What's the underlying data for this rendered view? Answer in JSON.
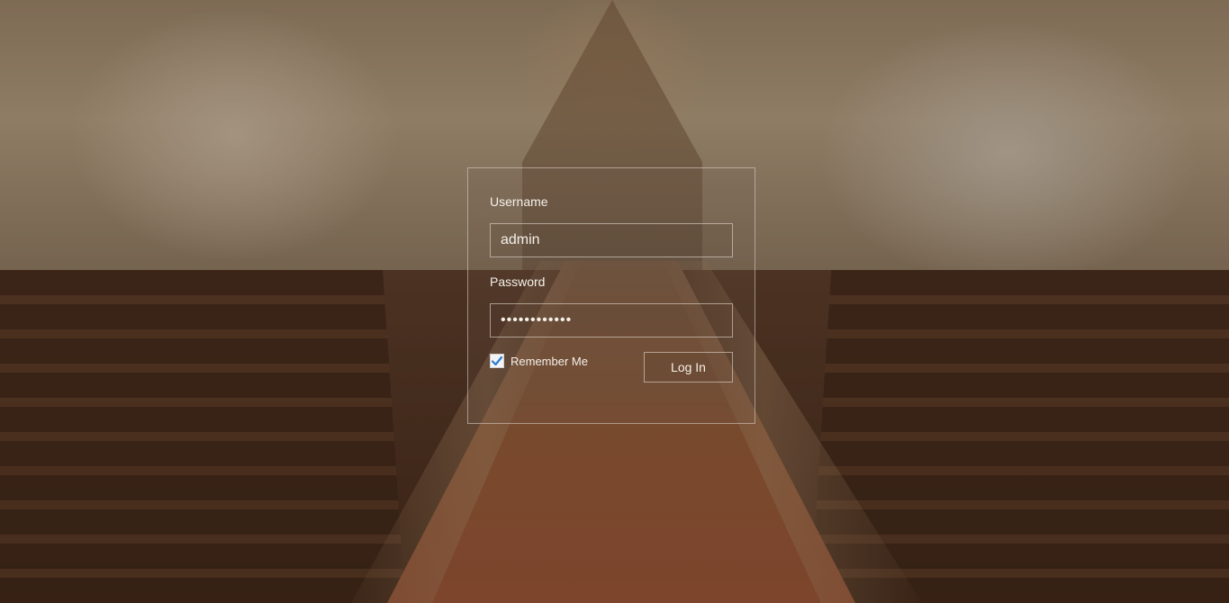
{
  "login": {
    "username_label": "Username",
    "username_value": "admin",
    "password_label": "Password",
    "password_value": "••••••••••••",
    "remember_label": "Remember Me",
    "remember_checked": true,
    "submit_label": "Log In"
  },
  "icons": {
    "checkmark": "checkmark-icon"
  },
  "colors": {
    "text": "#f5f0ea",
    "check": "#2a7bd0"
  }
}
